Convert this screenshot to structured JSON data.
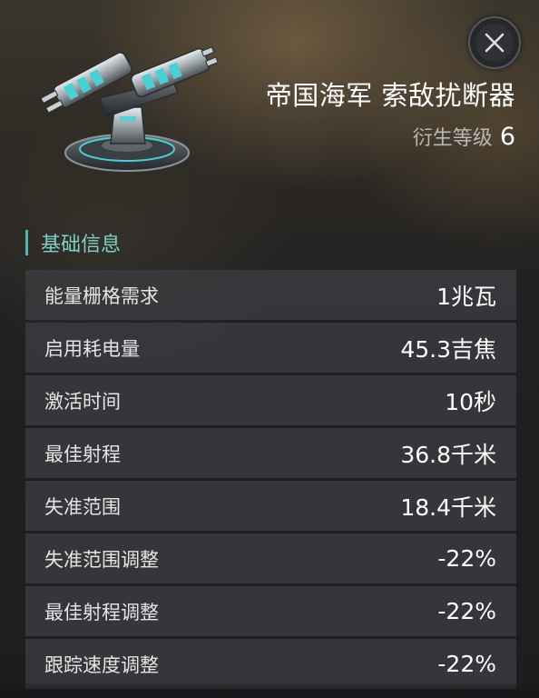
{
  "item": {
    "name": "帝国海军 索敌扰断器",
    "meta_level_label": "衍生等级",
    "meta_level_value": "6"
  },
  "section": {
    "title": "基础信息"
  },
  "stats": [
    {
      "label": "能量栅格需求",
      "value": "1兆瓦"
    },
    {
      "label": "启用耗电量",
      "value": "45.3吉焦"
    },
    {
      "label": "激活时间",
      "value": "10秒"
    },
    {
      "label": "最佳射程",
      "value": "36.8千米"
    },
    {
      "label": "失准范围",
      "value": "18.4千米"
    },
    {
      "label": "失准范围调整",
      "value": "-22%"
    },
    {
      "label": "最佳射程调整",
      "value": "-22%"
    },
    {
      "label": "跟踪速度调整",
      "value": "-22%"
    }
  ],
  "icons": {
    "close": "close-icon",
    "item": "turret-module-icon"
  },
  "colors": {
    "accent": "#4fb7b0",
    "section_title": "#7fd0c6",
    "row_bg": "#3a3c40",
    "text": "#ffffff"
  }
}
